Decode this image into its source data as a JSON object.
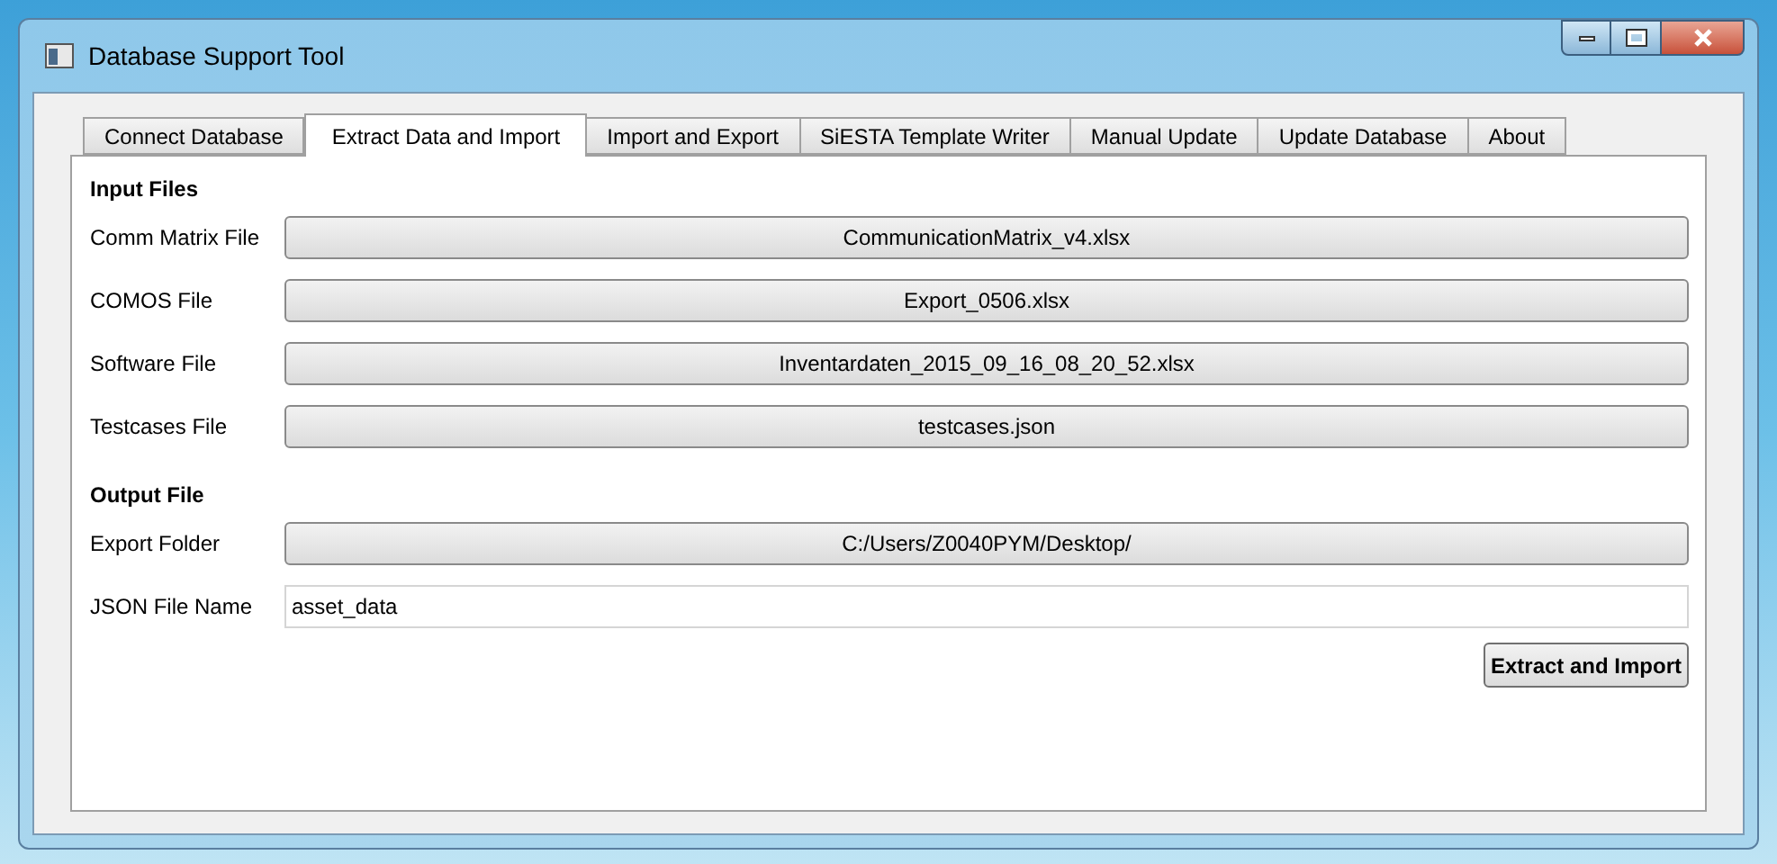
{
  "window": {
    "title": "Database Support Tool"
  },
  "tabs": [
    {
      "label": "Connect Database",
      "selected": false
    },
    {
      "label": "Extract Data and Import",
      "selected": true
    },
    {
      "label": "Import and Export",
      "selected": false
    },
    {
      "label": "SiESTA Template Writer",
      "selected": false
    },
    {
      "label": "Manual Update",
      "selected": false
    },
    {
      "label": "Update Database",
      "selected": false
    },
    {
      "label": "About",
      "selected": false
    }
  ],
  "sections": [
    {
      "title": "Input Files",
      "rows": [
        {
          "label": "Comm Matrix File",
          "kind": "file-button",
          "value": "CommunicationMatrix_v4.xlsx"
        },
        {
          "label": "COMOS File",
          "kind": "file-button",
          "value": "Export_0506.xlsx"
        },
        {
          "label": "Software File",
          "kind": "file-button",
          "value": "Inventardaten_2015_09_16_08_20_52.xlsx"
        },
        {
          "label": "Testcases File",
          "kind": "file-button",
          "value": "testcases.json"
        }
      ]
    },
    {
      "title": "Output File",
      "rows": [
        {
          "label": "Export Folder",
          "kind": "file-button",
          "value": "C:/Users/Z0040PYM/Desktop/"
        },
        {
          "label": "JSON File Name",
          "kind": "text-field",
          "value": "asset_data"
        }
      ]
    }
  ],
  "action_button": "Extract and Import"
}
